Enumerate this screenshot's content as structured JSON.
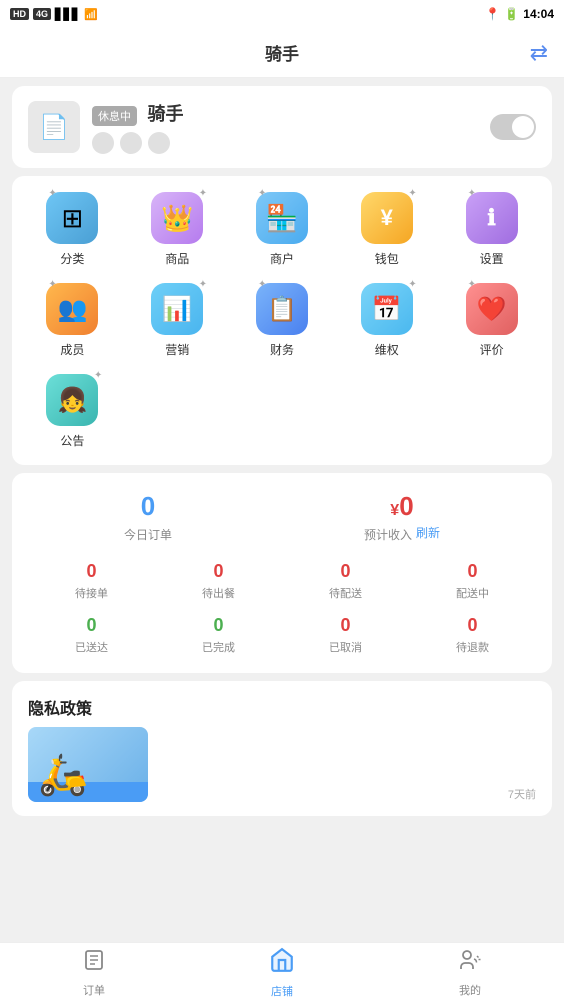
{
  "statusBar": {
    "left": "HD 4G",
    "time": "14:04",
    "batteryIcon": "🔋"
  },
  "header": {
    "title": "骑手",
    "switchIcon": "⇄"
  },
  "riderCard": {
    "tag": "休息中",
    "name": "骑手",
    "avatarIcon": "📄"
  },
  "menuItems": [
    {
      "id": "fenlei",
      "label": "分类",
      "icon": "⚏",
      "iconClass": "icon-fenlei",
      "emoji": "🔲"
    },
    {
      "id": "shangpin",
      "label": "商品",
      "icon": "👑",
      "iconClass": "icon-shangpin",
      "emoji": "👑"
    },
    {
      "id": "shanghu",
      "label": "商户",
      "icon": "🏠",
      "iconClass": "icon-shanghu",
      "emoji": "🏪"
    },
    {
      "id": "qianbao",
      "label": "钱包",
      "icon": "¥",
      "iconClass": "icon-qianbao",
      "emoji": "💰"
    },
    {
      "id": "shezhi",
      "label": "设置",
      "icon": "ℹ",
      "iconClass": "icon-shezhi",
      "emoji": "ℹ️"
    },
    {
      "id": "chengyuan",
      "label": "成员",
      "icon": "👥",
      "iconClass": "icon-chengyuan",
      "emoji": "👥"
    },
    {
      "id": "yingxiao",
      "label": "营销",
      "icon": "📊",
      "iconClass": "icon-yingxiao",
      "emoji": "📊"
    },
    {
      "id": "caiwu",
      "label": "财务",
      "icon": "📋",
      "iconClass": "icon-caiwu",
      "emoji": "📋"
    },
    {
      "id": "weiquan",
      "label": "维权",
      "icon": "📅",
      "iconClass": "icon-weiquan",
      "emoji": "📅"
    },
    {
      "id": "pingjia",
      "label": "评价",
      "icon": "❤",
      "iconClass": "icon-pingjia",
      "emoji": "❤️"
    },
    {
      "id": "gonggao",
      "label": "公告",
      "icon": "👧",
      "iconClass": "icon-gonggao",
      "emoji": "💬"
    }
  ],
  "stats": {
    "todayOrders": {
      "value": "0",
      "label": "今日订单"
    },
    "expectedIncome": {
      "yuan": "¥",
      "value": "0",
      "label": "预计收入",
      "refresh": "刷新"
    },
    "statusItems": [
      {
        "id": "waiting-accept",
        "value": "0",
        "label": "待接单",
        "color": "red"
      },
      {
        "id": "waiting-meal",
        "value": "0",
        "label": "待出餐",
        "color": "red"
      },
      {
        "id": "waiting-delivery",
        "value": "0",
        "label": "待配送",
        "color": "red"
      },
      {
        "id": "delivering",
        "value": "0",
        "label": "配送中",
        "color": "red"
      },
      {
        "id": "delivered",
        "value": "0",
        "label": "已送达",
        "color": "green"
      },
      {
        "id": "completed",
        "value": "0",
        "label": "已完成",
        "color": "green"
      },
      {
        "id": "cancelled",
        "value": "0",
        "label": "已取消",
        "color": "red"
      },
      {
        "id": "refund-pending",
        "value": "0",
        "label": "待退款",
        "color": "red"
      }
    ]
  },
  "privacyCard": {
    "title": "隐私政策",
    "time": "7天前"
  },
  "bottomNav": [
    {
      "id": "orders",
      "label": "订单",
      "icon": "📋",
      "active": false
    },
    {
      "id": "shop",
      "label": "店铺",
      "icon": "🏠",
      "active": true
    },
    {
      "id": "mine",
      "label": "我的",
      "icon": "💬",
      "active": false
    }
  ]
}
